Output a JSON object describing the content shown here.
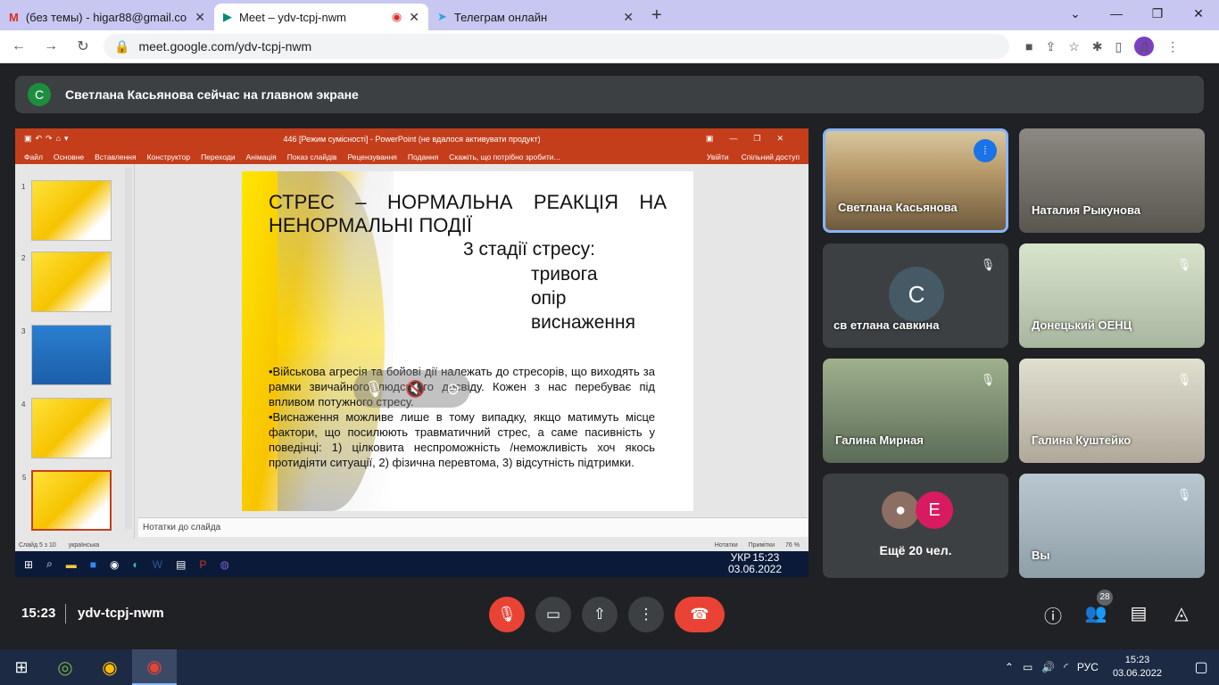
{
  "browser": {
    "tabs": [
      {
        "icon": "gmail-icon",
        "title": "(без темы) - higar88@gmail.com"
      },
      {
        "icon": "meet-icon",
        "title": "Meet – ydv-tcpj-nwm",
        "recording": true
      },
      {
        "icon": "telegram-icon",
        "title": "Телеграм онлайн"
      }
    ],
    "url": "meet.google.com/ydv-tcpj-nwm",
    "profile_initial": "Д"
  },
  "banner": {
    "avatar_letter": "С",
    "text": "Светлана Касьянова сейчас на главном экране"
  },
  "powerpoint": {
    "window_title": "446 [Режим сумісності] - PowerPoint (не вдалося активувати продукт)",
    "ribbon": [
      "Файл",
      "Основне",
      "Вставлення",
      "Конструктор",
      "Переходи",
      "Анімація",
      "Показ слайдів",
      "Рецензування",
      "Подання",
      "Скажіть, що потрібно зробити..."
    ],
    "ribbon_right": [
      "Увійти",
      "Спільний доступ"
    ],
    "thumb_numbers": [
      "1",
      "2",
      "3",
      "4",
      "5"
    ],
    "slide": {
      "title": "СТРЕС – НОРМАЛЬНА РЕАКЦІЯ НА НЕНОРМАЛЬНІ ПОДІЇ",
      "subtitle": "3 стадії стресу:",
      "stages": [
        "тривога",
        "опір",
        "виснаження"
      ],
      "body1": "•Військова агресія та бойові дії належать до стресорів, що виходять за рамки звичайного людського досвіду. Кожен з нас перебуває під впливом потужного стресу.",
      "body2": " •Виснаження можливе лише в тому випадку, якщо матимуть місце фактори, що посилюють травматичний стрес, а саме пасивність у поведінці: 1) цілковита неспроможність /неможливість хоч якось протидіяти ситуації, 2) фізична перевтома, 3) відсутність підтримки."
    },
    "notes_placeholder": "Нотатки до слайда",
    "status_left": [
      "Слайд 5 з 10",
      "українська"
    ],
    "status_right": [
      "Нотатки",
      "Примітки",
      "76 %"
    ],
    "inner_clock": {
      "time": "15:23",
      "date": "03.06.2022",
      "lang": "УКР"
    }
  },
  "participants": [
    {
      "name": "Светлана Касьянова",
      "speaking": true
    },
    {
      "name": "Наталия Рыкунова"
    },
    {
      "name": "св етлана савкина",
      "avatar_letter": "С",
      "muted": true
    },
    {
      "name": "Донецький ОЕНЦ",
      "muted": true
    },
    {
      "name": "Галина Мирная",
      "muted": true
    },
    {
      "name": "Галина Куштейко",
      "muted": true
    },
    {
      "name": "Вы",
      "muted": true
    }
  ],
  "more": {
    "label": "Ещё 20 чел.",
    "avatar_letter": "Е",
    "avatar_color": "#d81b60"
  },
  "meeting": {
    "time": "15:23",
    "code": "ydv-tcpj-nwm",
    "people_count": "28"
  },
  "taskbar": {
    "lang": "РУС",
    "time": "15:23",
    "date": "03.06.2022"
  },
  "colors": {
    "end_call": "#ea4335",
    "powerpoint": "#c43e1c",
    "speaking_border": "#8ab4f8"
  }
}
